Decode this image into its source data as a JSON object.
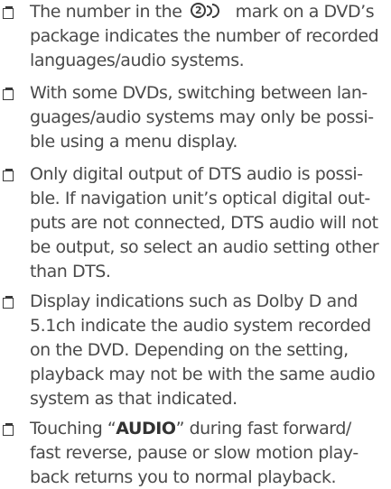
{
  "notes": [
    {
      "lines": [
        {
          "before": "The number in the",
          "glyph_text": "2",
          "after": "mark on a DVD’s"
        },
        "package indicates the number of recorded",
        "languages/audio systems."
      ]
    },
    {
      "lines": [
        "With some DVDs, switching between lan-",
        "guages/audio systems may only be possi-",
        "ble using a menu display."
      ]
    },
    {
      "lines": [
        "Only digital output of DTS audio is possi-",
        "ble. If navigation unit’s optical digital out-",
        "puts are not connected, DTS audio will not",
        "be output, so select an audio setting other",
        "than DTS."
      ]
    },
    {
      "lines": [
        "Display indications such as Dolby D and",
        "5.1ch indicate the audio system recorded",
        "on the DVD. Depending on the setting,",
        "playback may not be with the same audio",
        "system as that indicated."
      ]
    },
    {
      "lines": [
        {
          "before": "Touching “",
          "bold": "AUDIO",
          "after": "” during fast forward/"
        },
        "fast reverse, pause or slow motion play-",
        "back returns you to normal playback."
      ]
    }
  ]
}
